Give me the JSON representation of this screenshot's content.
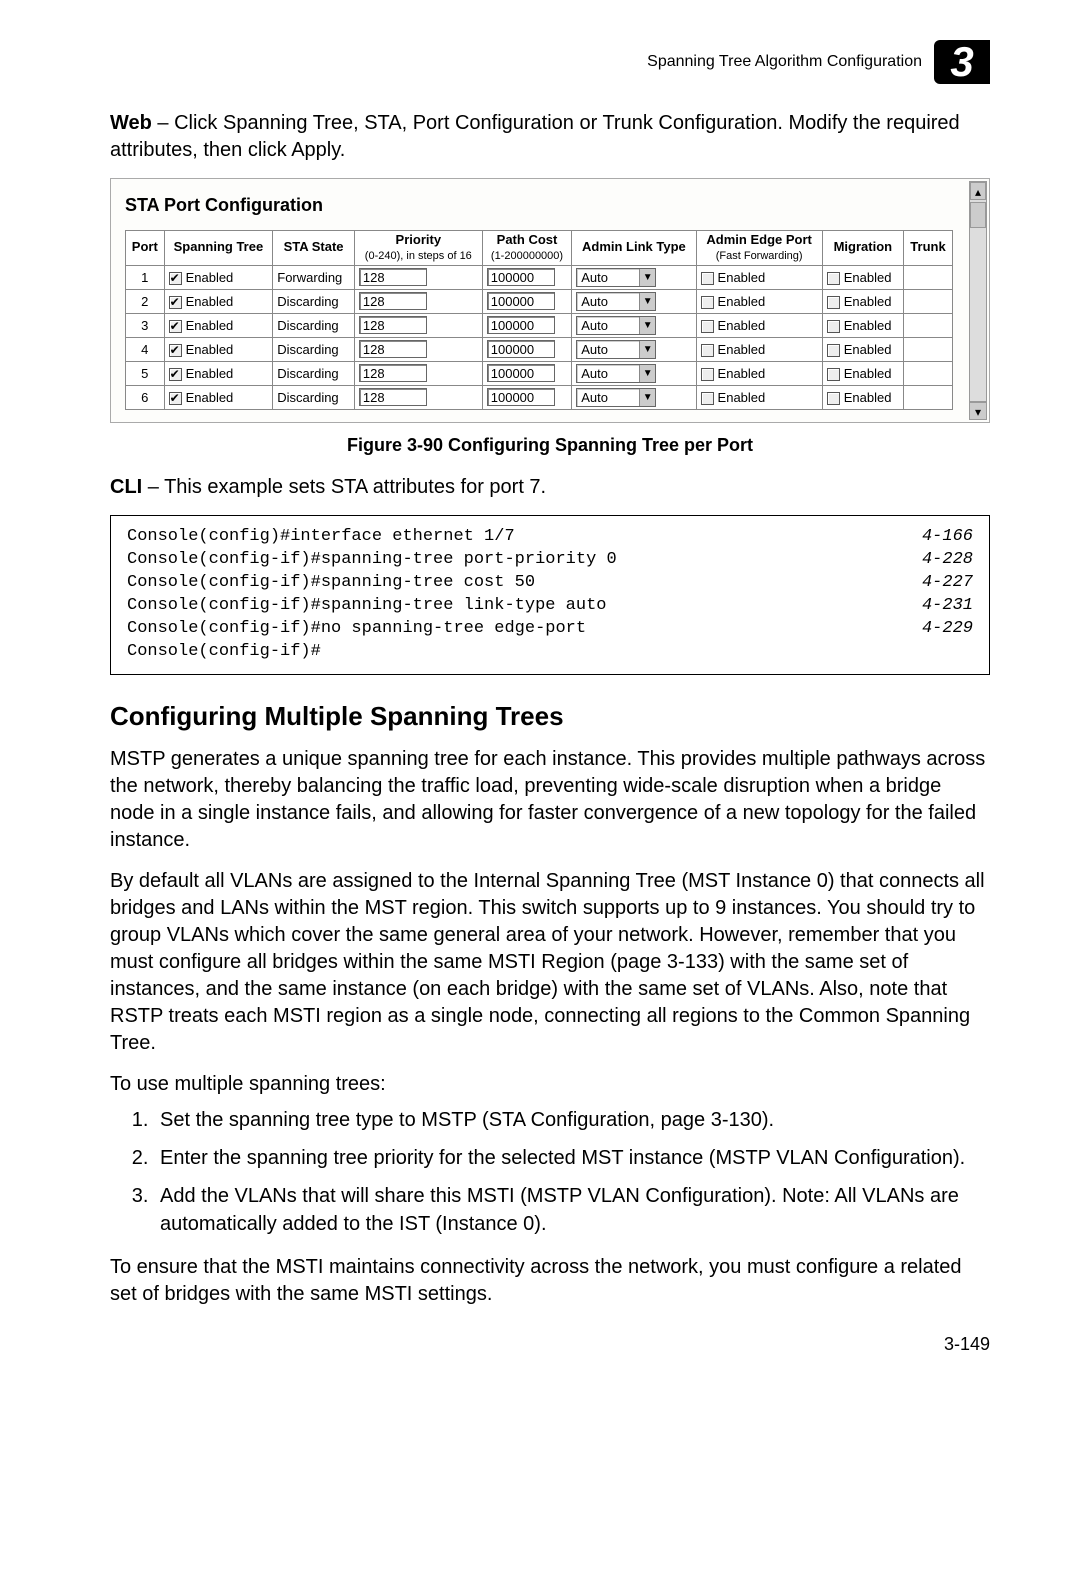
{
  "header": {
    "running_title": "Spanning Tree Algorithm Configuration",
    "chapter": "3"
  },
  "intro": {
    "web_label": "Web",
    "web_text": " – Click Spanning Tree, STA, Port Configuration or Trunk Configuration. Modify the required attributes, then click Apply."
  },
  "panel": {
    "title": "STA Port Configuration",
    "headers": {
      "port": "Port",
      "spanning_tree": "Spanning Tree",
      "sta_state": "STA State",
      "priority": "Priority",
      "priority_sub": "(0-240), in steps of 16",
      "path_cost": "Path Cost",
      "path_cost_sub": "(1-200000000)",
      "admin_link": "Admin Link Type",
      "admin_edge": "Admin Edge Port",
      "admin_edge_sub": "(Fast Forwarding)",
      "migration": "Migration",
      "trunk": "Trunk"
    },
    "enabled_label": "Enabled",
    "auto_label": "Auto",
    "rows": [
      {
        "port": "1",
        "st_on": true,
        "state": "Forwarding",
        "priority": "128",
        "cost": "100000",
        "edge_on": false,
        "mig_on": false
      },
      {
        "port": "2",
        "st_on": true,
        "state": "Discarding",
        "priority": "128",
        "cost": "100000",
        "edge_on": false,
        "mig_on": false
      },
      {
        "port": "3",
        "st_on": true,
        "state": "Discarding",
        "priority": "128",
        "cost": "100000",
        "edge_on": false,
        "mig_on": false
      },
      {
        "port": "4",
        "st_on": true,
        "state": "Discarding",
        "priority": "128",
        "cost": "100000",
        "edge_on": false,
        "mig_on": false
      },
      {
        "port": "5",
        "st_on": true,
        "state": "Discarding",
        "priority": "128",
        "cost": "100000",
        "edge_on": false,
        "mig_on": false
      },
      {
        "port": "6",
        "st_on": true,
        "state": "Discarding",
        "priority": "128",
        "cost": "100000",
        "edge_on": false,
        "mig_on": false
      }
    ]
  },
  "figcap": "Figure 3-90  Configuring Spanning Tree per Port",
  "cli_intro_label": "CLI",
  "cli_intro_text": " – This example sets STA attributes for port 7.",
  "cli": [
    {
      "cmd": "Console(config)#interface ethernet 1/7",
      "ref": "4-166"
    },
    {
      "cmd": "Console(config-if)#spanning-tree port-priority 0",
      "ref": "4-228"
    },
    {
      "cmd": "Console(config-if)#spanning-tree cost 50",
      "ref": "4-227"
    },
    {
      "cmd": "Console(config-if)#spanning-tree link-type auto",
      "ref": "4-231"
    },
    {
      "cmd": "Console(config-if)#no spanning-tree edge-port",
      "ref": "4-229"
    },
    {
      "cmd": "Console(config-if)#",
      "ref": ""
    }
  ],
  "section_title": "Configuring Multiple Spanning Trees",
  "para1": "MSTP generates a unique spanning tree for each instance. This provides multiple pathways across the network, thereby balancing the traffic load, preventing wide-scale disruption when a bridge node in a single instance fails, and allowing for faster convergence of a new topology for the failed instance.",
  "para2": "By default all VLANs are assigned to the Internal Spanning Tree (MST Instance 0) that connects all bridges and LANs within the MST region. This switch supports up to 9 instances. You should try to group VLANs which cover the same general area of your network. However, remember that you must configure all bridges within the same MSTI Region (page 3-133) with the same set of instances, and the same instance (on each bridge) with the same set of VLANs. Also, note that RSTP treats each MSTI region as a single node, connecting all regions to the Common Spanning Tree.",
  "para3": "To use multiple spanning trees:",
  "steps": [
    "Set the spanning tree type to MSTP (STA Configuration, page 3-130).",
    "Enter the spanning tree priority for the selected MST instance (MSTP VLAN Configuration).",
    "Add the VLANs that will share this MSTI (MSTP VLAN Configuration). Note: All VLANs are automatically added to the IST (Instance 0)."
  ],
  "para4": "To ensure that the MSTI maintains connectivity across the network, you must configure a related set of bridges with the same MSTI settings.",
  "pagenum": "3-149"
}
